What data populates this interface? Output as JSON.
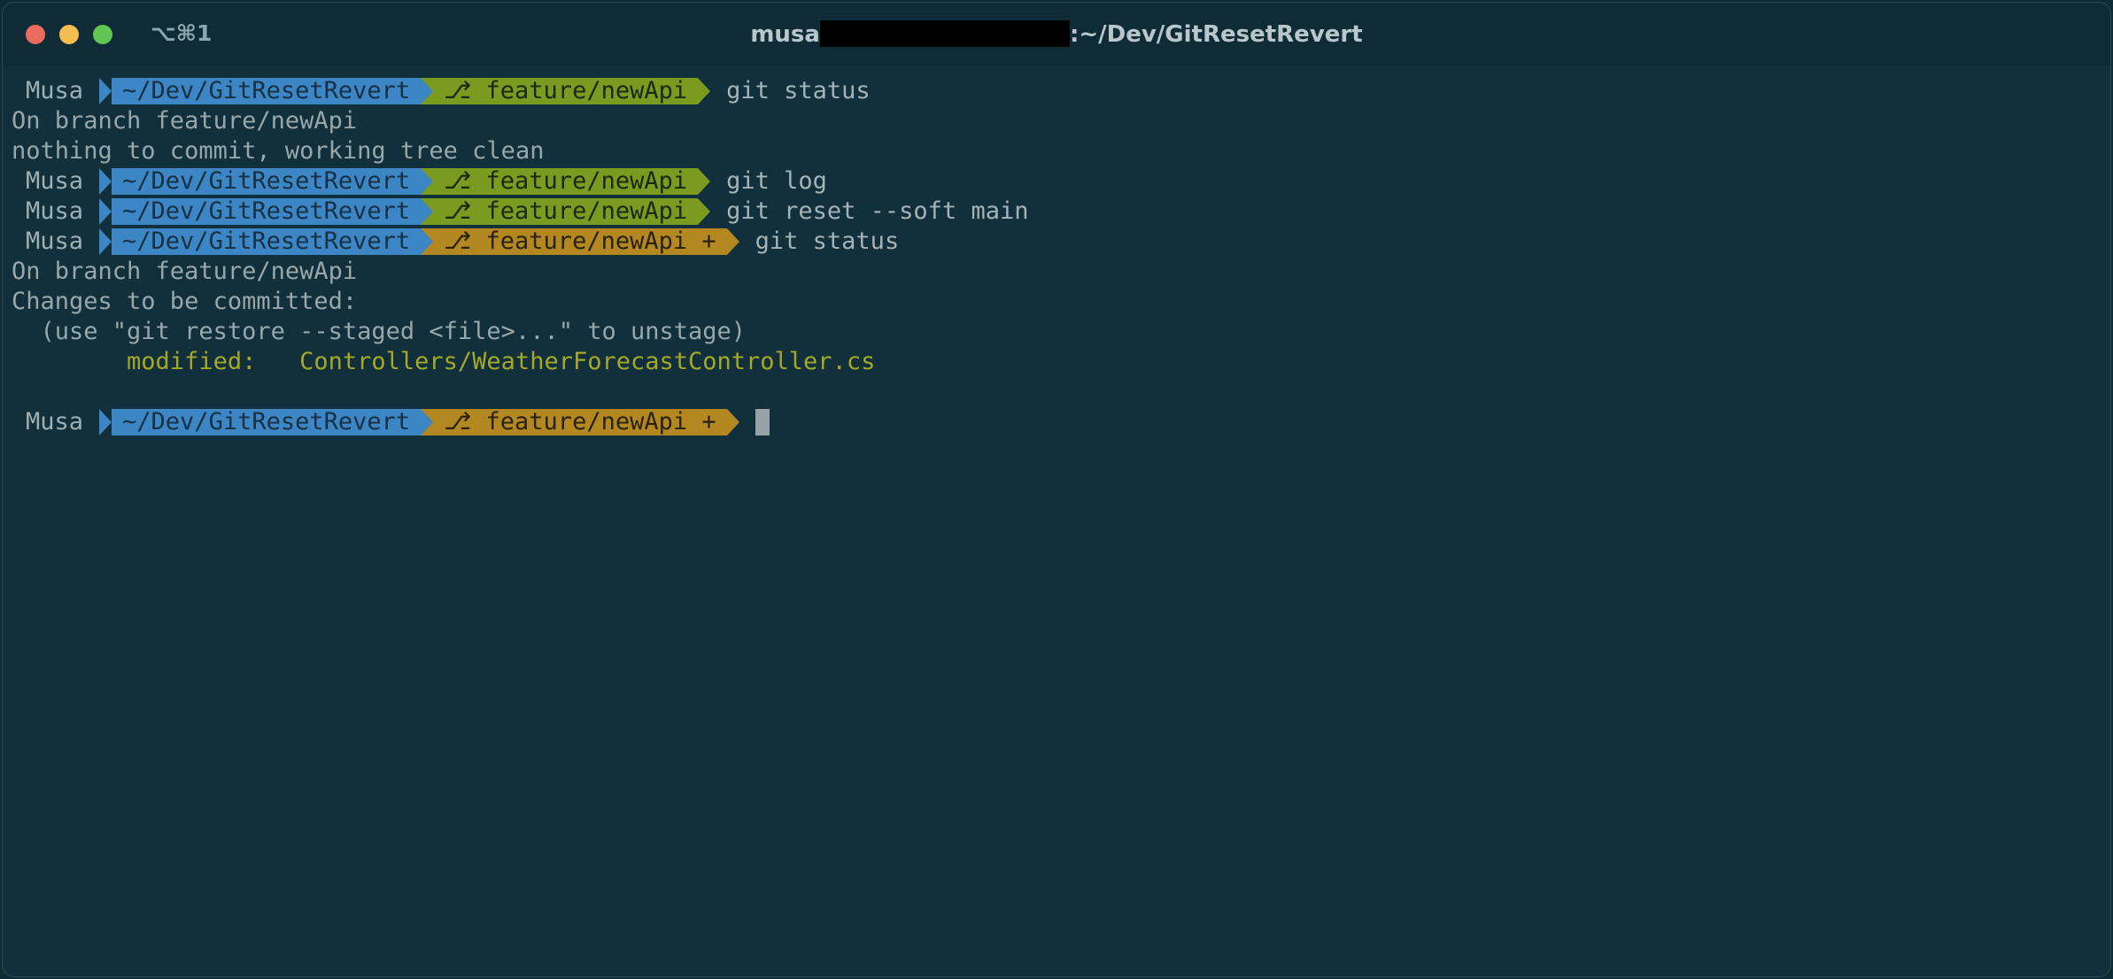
{
  "window": {
    "shortcut": "⌥⌘1",
    "title_prefix": "musa",
    "title_suffix": ":~/Dev/GitResetRevert"
  },
  "prompt": {
    "user": "Musa",
    "path": "~/Dev/GitResetRevert",
    "branch_icon": "⎇",
    "branch": "feature/newApi",
    "dirty_marker": "+"
  },
  "lines": [
    {
      "type": "prompt",
      "dirty": false,
      "command": "git status"
    },
    {
      "type": "output",
      "text": "On branch feature/newApi"
    },
    {
      "type": "output",
      "text": "nothing to commit, working tree clean"
    },
    {
      "type": "prompt",
      "dirty": false,
      "command": "git log"
    },
    {
      "type": "prompt",
      "dirty": false,
      "command": "git reset --soft main"
    },
    {
      "type": "prompt",
      "dirty": true,
      "command": "git status"
    },
    {
      "type": "output",
      "text": "On branch feature/newApi"
    },
    {
      "type": "output",
      "text": "Changes to be committed:"
    },
    {
      "type": "output",
      "text": "  (use \"git restore --staged <file>...\" to unstage)"
    },
    {
      "type": "modified",
      "label": "        modified:   ",
      "file": "Controllers/WeatherForecastController.cs"
    },
    {
      "type": "blank"
    },
    {
      "type": "prompt",
      "dirty": true,
      "command": "",
      "cursor": true
    }
  ],
  "colors": {
    "background": "#11303b",
    "path_segment": "#3c86c5",
    "branch_clean": "#7a9a20",
    "branch_dirty": "#b38820",
    "modified_text": "#a4a828"
  }
}
